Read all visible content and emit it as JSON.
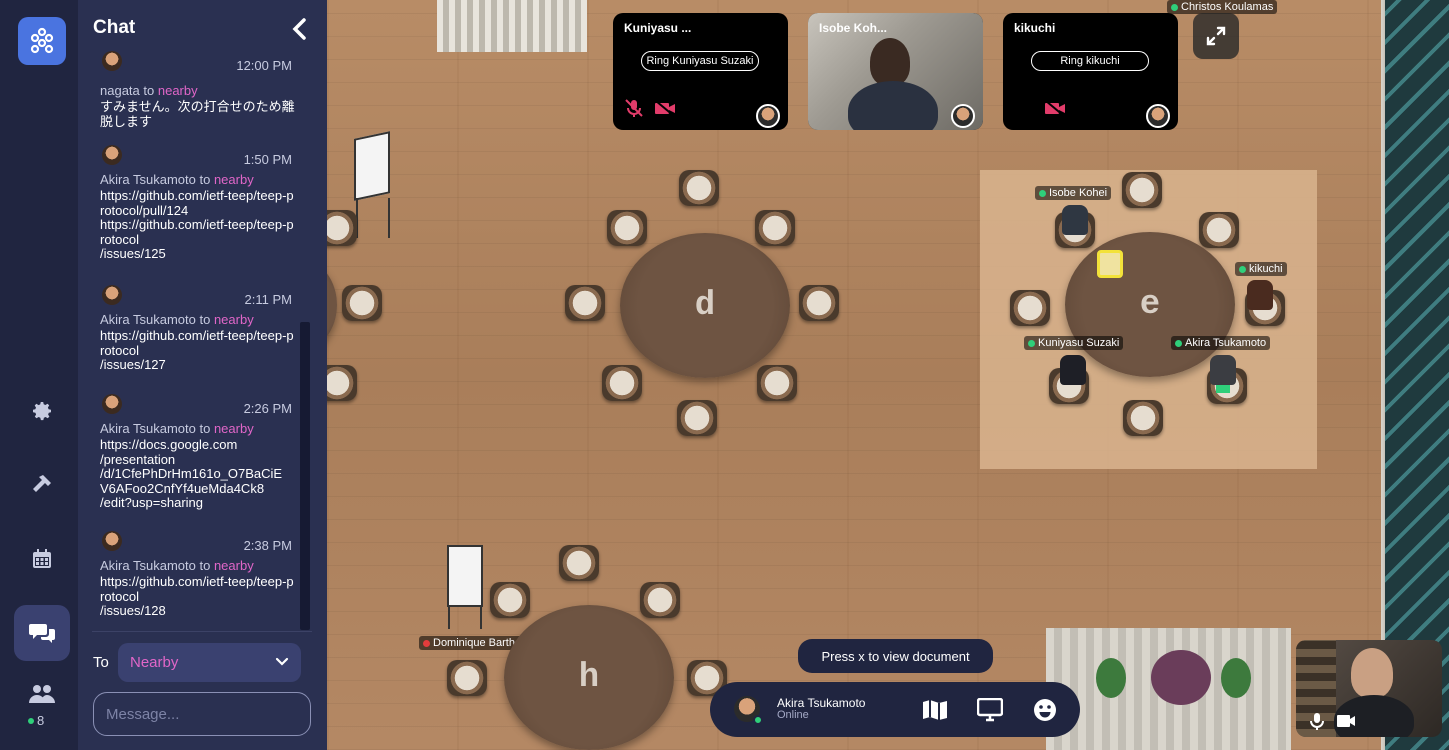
{
  "chat": {
    "title": "Chat",
    "messages": [
      {
        "time": "12:00 PM",
        "sender": "nagata",
        "to": "to",
        "target": "nearby",
        "text": "すみません。次の打合せのため離脱します"
      },
      {
        "time": "1:50 PM",
        "sender": "Akira Tsukamoto",
        "to": "to",
        "target": "nearby",
        "text": "https://github.com/ietf-teep/teep-protocol/pull/124\nhttps://github.com/ietf-teep/teep-protocol\n/issues/125"
      },
      {
        "time": "2:11 PM",
        "sender": "Akira Tsukamoto",
        "to": "to",
        "target": "nearby",
        "text": "https://github.com/ietf-teep/teep-protocol\n/issues/127"
      },
      {
        "time": "2:26 PM",
        "sender": "Akira Tsukamoto",
        "to": "to",
        "target": "nearby",
        "text": "https://docs.google.com\n/presentation\n/d/1CfePhDrHm161o_O7BaCiE\nV6AFoo2CnfYf4ueMda4Ck8\n/edit?usp=sharing"
      },
      {
        "time": "2:38 PM",
        "sender": "Akira Tsukamoto",
        "to": "to",
        "target": "nearby",
        "text": "https://github.com/ietf-teep/teep-protocol\n/issues/128"
      }
    ],
    "to_label": "To",
    "to_value": "Nearby",
    "message_placeholder": "Message..."
  },
  "rail": {
    "participants_count": "8"
  },
  "video_tiles": [
    {
      "name": "Kuniyasu ...",
      "ring_label": "Ring Kuniyasu Suzaki"
    },
    {
      "name": "Isobe Koh..."
    },
    {
      "name": "kikuchi",
      "ring_label": "Ring kikuchi"
    }
  ],
  "map": {
    "tables": [
      "d",
      "e",
      "h"
    ],
    "nametags": {
      "christos": "Christos Koulamas",
      "isobe": "Isobe Kohei",
      "kikuchi": "kikuchi",
      "kuniyasu": "Kuniyasu Suzaki",
      "akira": "Akira Tsukamoto",
      "dominique": "Dominique Barthel"
    },
    "hint": "Press x to view document"
  },
  "bottom_bar": {
    "user_name": "Akira Tsukamoto",
    "user_status": "Online"
  },
  "colors": {
    "accent": "#e066c8",
    "online": "#2fcf7a",
    "offline": "#e23c3c",
    "panel": "#2a3051",
    "rail": "#202540"
  }
}
